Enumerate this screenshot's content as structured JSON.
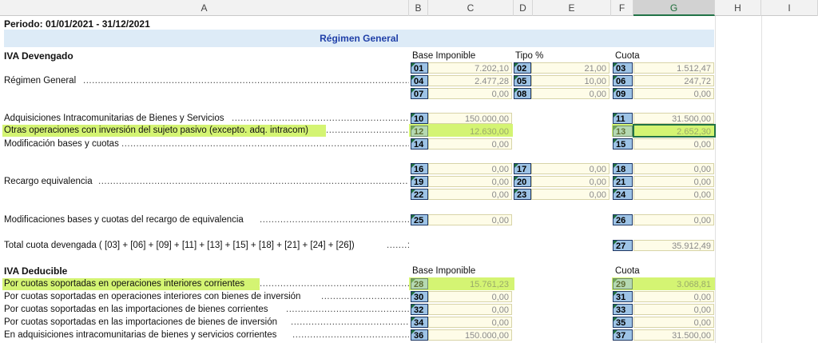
{
  "columns": [
    "A",
    "B",
    "C",
    "D",
    "E",
    "F",
    "G",
    "H",
    "I"
  ],
  "period": "Periodo: 01/01/2021 - 31/12/2021",
  "banner": "Régimen General",
  "devengado": {
    "title": "IVA Devengado",
    "col_base": "Base Imponible",
    "col_tipo": "Tipo %",
    "col_cuota": "Cuota",
    "regimen_label": "Régimen General",
    "rows": [
      {
        "c1": "01",
        "v1": "7.202,10",
        "c2": "02",
        "v2": "21,00",
        "c3": "03",
        "v3": "1.512,47"
      },
      {
        "c1": "04",
        "v1": "2.477,28",
        "c2": "05",
        "v2": "10,00",
        "c3": "06",
        "v3": "247,72"
      },
      {
        "c1": "07",
        "v1": "0,00",
        "c2": "08",
        "v2": "0,00",
        "c3": "09",
        "v3": "0,00"
      }
    ],
    "adq_label": "Adquisiciones Intracomunitarias de Bienes y Servicios",
    "adq": {
      "c1": "10",
      "v1": "150.000,00",
      "c3": "11",
      "v3": "31.500,00"
    },
    "otras_label": "Otras operaciones con inversión del sujeto pasivo (excepto. adq. intracom)",
    "otras": {
      "c1": "12",
      "v1": "12.630,00",
      "c3": "13",
      "v3": "2.652,30"
    },
    "mod_label": "Modificación bases y cuotas",
    "mod": {
      "c1": "14",
      "v1": "0,00",
      "c3": "15",
      "v3": "0,00"
    },
    "recargo_label": "Recargo equivalencia",
    "recargo_rows": [
      {
        "c1": "16",
        "v1": "0,00",
        "c2": "17",
        "v2": "0,00",
        "c3": "18",
        "v3": "0,00"
      },
      {
        "c1": "19",
        "v1": "0,00",
        "c2": "20",
        "v2": "0,00",
        "c3": "21",
        "v3": "0,00"
      },
      {
        "c1": "22",
        "v1": "0,00",
        "c2": "23",
        "v2": "0,00",
        "c3": "24",
        "v3": "0,00"
      }
    ],
    "modrec_label": "Modificaciones bases y cuotas del recargo de equivalencia",
    "modrec": {
      "c1": "25",
      "v1": "0,00",
      "c3": "26",
      "v3": "0,00"
    },
    "total_label": "Total cuota devengada ( [03] + [06] + [09] + [11] + [13] + [15] + [18] + [21] + [24] + [26])",
    "total": {
      "c3": "27",
      "v3": "35.912,49"
    }
  },
  "deducible": {
    "title": "IVA Deducible",
    "col_base": "Base Imponible",
    "col_cuota": "Cuota",
    "rows": [
      {
        "label": "Por cuotas soportadas en operaciones interiores corrientes",
        "c1": "28",
        "v1": "15.761,23",
        "c3": "29",
        "v3": "3.068,81"
      },
      {
        "label": "Por cuotas soportadas en operaciones interiores con bienes de inversión",
        "c1": "30",
        "v1": "0,00",
        "c3": "31",
        "v3": "0,00"
      },
      {
        "label": "Por cuotas soportadas en las importaciones de bienes corrientes",
        "c1": "32",
        "v1": "0,00",
        "c3": "33",
        "v3": "0,00"
      },
      {
        "label": "Por cuotas soportadas en las importaciones de bienes de inversión",
        "c1": "34",
        "v1": "0,00",
        "c3": "35",
        "v3": "0,00"
      },
      {
        "label": "En adquisiciones intracomunitarias de bienes y servicios corrientes",
        "c1": "36",
        "v1": "150.000,00",
        "c3": "37",
        "v3": "31.500,00"
      }
    ]
  },
  "colors": {
    "highlight": "#cdf25a",
    "code_bg": "#9dc3e6",
    "value_bg": "#fefce8",
    "banner_bg": "#ddebf7",
    "selection": "#217346"
  }
}
